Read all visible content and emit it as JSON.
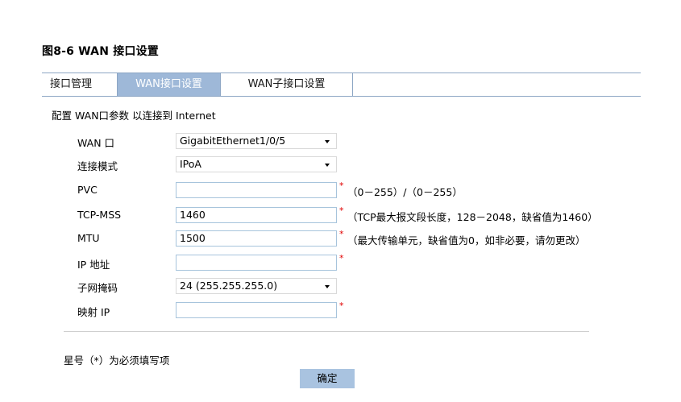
{
  "figure_title": "图8-6 WAN 接口设置",
  "tabs": [
    {
      "label": "接口管理"
    },
    {
      "label": "WAN接口设置"
    },
    {
      "label": "WAN子接口设置"
    }
  ],
  "form": {
    "intro": "配置 WAN口参数 以连接到 Internet",
    "rows": [
      {
        "label": "WAN 口",
        "value": "GigabitEthernet1/0/5",
        "hint": ""
      },
      {
        "label": "连接模式",
        "value": "IPoA",
        "hint": ""
      },
      {
        "label": "PVC",
        "value": "",
        "required": "*",
        "hint": "（0－255）/（0－255）"
      },
      {
        "label": "TCP-MSS",
        "value": "1460",
        "required": "*",
        "hint": "（TCP最大报文段长度，128－2048，缺省值为1460）"
      },
      {
        "label": "MTU",
        "value": "1500",
        "required": "*",
        "hint": "（最大传输单元，缺省值为0，如非必要，请勿更改）"
      },
      {
        "label": "IP 地址",
        "value": "",
        "required": "*",
        "hint": ""
      },
      {
        "label": "子网掩码",
        "value": "24 (255.255.255.0)",
        "hint": ""
      },
      {
        "label": "映射  IP",
        "value": "",
        "required": "*",
        "hint": ""
      }
    ],
    "footnote": "星号（*）为必须填写项",
    "ok_label": "确定"
  },
  "colors": {
    "tab_active_bg": "#9eb8d8",
    "tab_border": "#8da6c4",
    "input_border": "#a7c4dc",
    "required_star": "#e00000",
    "button_bg": "#a9c3e0"
  }
}
